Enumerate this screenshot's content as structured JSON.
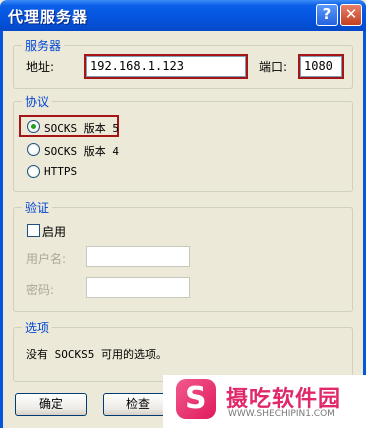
{
  "window": {
    "title": "代理服务器",
    "help_label": "?",
    "close_label": "✕"
  },
  "server": {
    "group_label": "服务器",
    "address_label": "地址:",
    "address_value": "192.168.1.123",
    "port_label": "端口:",
    "port_value": "1080"
  },
  "protocol": {
    "group_label": "协议",
    "options": [
      {
        "label": "SOCKS 版本 5",
        "selected": true
      },
      {
        "label": "SOCKS 版本 4",
        "selected": false
      },
      {
        "label": "HTTPS",
        "selected": false
      }
    ]
  },
  "auth": {
    "group_label": "验证",
    "enable_label": "启用",
    "enabled": false,
    "username_label": "用户名:",
    "password_label": "密码:"
  },
  "options": {
    "group_label": "选项",
    "text": "没有 SOCKS5 可用的选项。"
  },
  "buttons": {
    "ok_label": "确定",
    "check_label": "检查"
  },
  "watermark": {
    "name": "摄吃软件园",
    "url": "WWW.SHECHIPIN1.COM"
  },
  "colors": {
    "title_bar": "#0555e0",
    "group_label": "#0046d5",
    "highlight": "#a51515",
    "watermark": "#e0286b"
  }
}
